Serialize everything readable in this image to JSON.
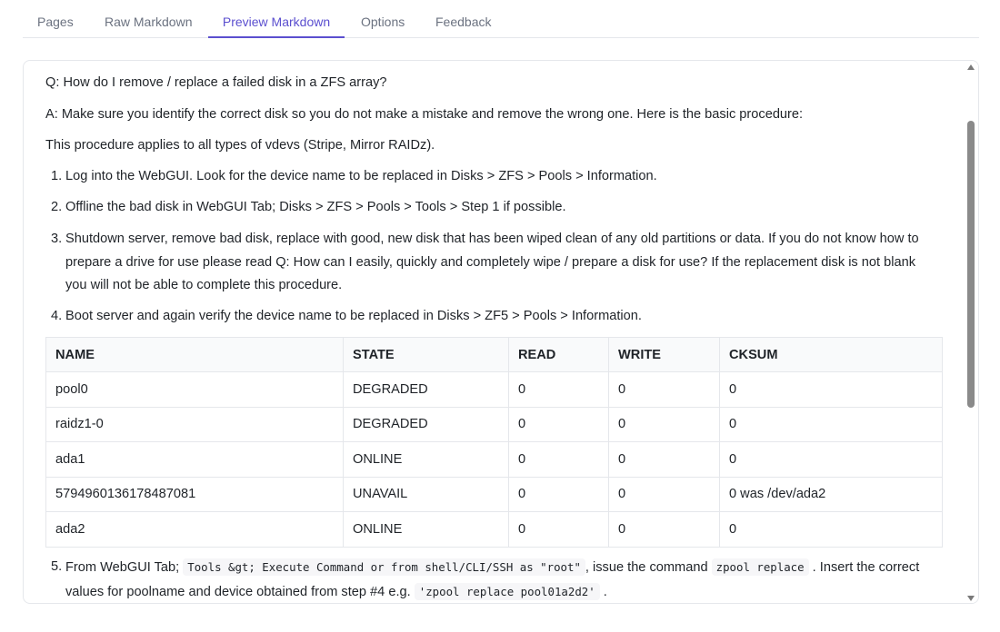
{
  "tabs": [
    "Pages",
    "Raw Markdown",
    "Preview Markdown",
    "Options",
    "Feedback"
  ],
  "active_tab": "Preview Markdown",
  "accent_color": "#5b4fcf",
  "doc": {
    "question": "Q: How do I remove / replace a failed disk in a ZFS array?",
    "answer": "A: Make sure you identify the correct disk so you do not make a mistake and remove the wrong one. Here is the basic procedure:",
    "applies": "This procedure applies to all types of vdevs (Stripe, Mirror RAIDz).",
    "steps": [
      {
        "num": "1.",
        "text": "Log into the WebGUI. Look for the device name to be replaced in Disks > ZFS > Pools > Information."
      },
      {
        "num": "2.",
        "text": "Offline the bad disk in WebGUI Tab; Disks > ZFS > Pools > Tools > Step 1 if possible."
      },
      {
        "num": "3.",
        "text": "Shutdown server, remove bad disk, replace with good, new disk that has been wiped clean of any old partitions or data. If you do not know how to prepare a drive for use please read Q: How can I easily, quickly and completely wipe / prepare a disk for use? If the replacement disk is not blank you will not be able to complete this procedure."
      },
      {
        "num": "4.",
        "text": "Boot server and again verify the device name to be replaced in Disks > ZF5 > Pools > Information."
      }
    ],
    "table": {
      "headers": [
        "NAME",
        "STATE",
        "READ",
        "WRITE",
        "CKSUM"
      ],
      "rows": [
        [
          "pool0",
          "DEGRADED",
          "0",
          "0",
          "0"
        ],
        [
          "raidz1-0",
          "DEGRADED",
          "0",
          "0",
          "0"
        ],
        [
          "ada1",
          "ONLINE",
          "0",
          "0",
          "0"
        ],
        [
          "5794960136178487081",
          "UNAVAIL",
          "0",
          "0",
          "0 was /dev/ada2"
        ],
        [
          "ada2",
          "ONLINE",
          "0",
          "0",
          "0"
        ]
      ]
    },
    "step5": {
      "num": "5.",
      "t1": "From WebGUI Tab;",
      "code1": "Tools &gt; Execute Command or from shell/CLI/SSH as \"root\"",
      "t2": ", issue the command",
      "code2": "zpool replace",
      "t3": ". Insert the correct values for poolname and device obtained from step #4 e.g.",
      "code3": "'zpool replace pool01a2d2'",
      "t4": "."
    }
  }
}
